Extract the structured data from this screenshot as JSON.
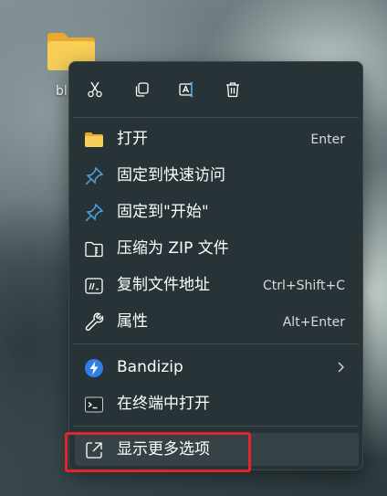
{
  "desktop": {
    "icon_label": "bl"
  },
  "quick_actions": [
    {
      "name": "cut",
      "icon": "scissors-icon"
    },
    {
      "name": "copy",
      "icon": "copy-icon"
    },
    {
      "name": "rename",
      "icon": "rename-icon"
    },
    {
      "name": "delete",
      "icon": "trash-icon"
    }
  ],
  "menu": {
    "items": [
      {
        "label": "打开",
        "shortcut": "Enter",
        "icon": "folder-icon"
      },
      {
        "label": "固定到快速访问",
        "shortcut": "",
        "icon": "pin-icon"
      },
      {
        "label": "固定到\"开始\"",
        "shortcut": "",
        "icon": "pin-icon"
      },
      {
        "label": "压缩为 ZIP 文件",
        "shortcut": "",
        "icon": "zip-folder-icon"
      },
      {
        "label": "复制文件地址",
        "shortcut": "Ctrl+Shift+C",
        "icon": "copy-path-icon"
      },
      {
        "label": "属性",
        "shortcut": "Alt+Enter",
        "icon": "wrench-icon"
      },
      {
        "label": "Bandizip",
        "shortcut": "",
        "icon": "bandizip-icon",
        "has_submenu": true
      },
      {
        "label": "在终端中打开",
        "shortcut": "",
        "icon": "terminal-icon"
      },
      {
        "label": "显示更多选项",
        "shortcut": "",
        "icon": "external-link-icon"
      }
    ]
  },
  "colors": {
    "menu_bg": "#273336",
    "pin_blue": "#4aa3e0",
    "folder_yellow": "#f5c44a",
    "highlight_red": "#e3242b"
  }
}
